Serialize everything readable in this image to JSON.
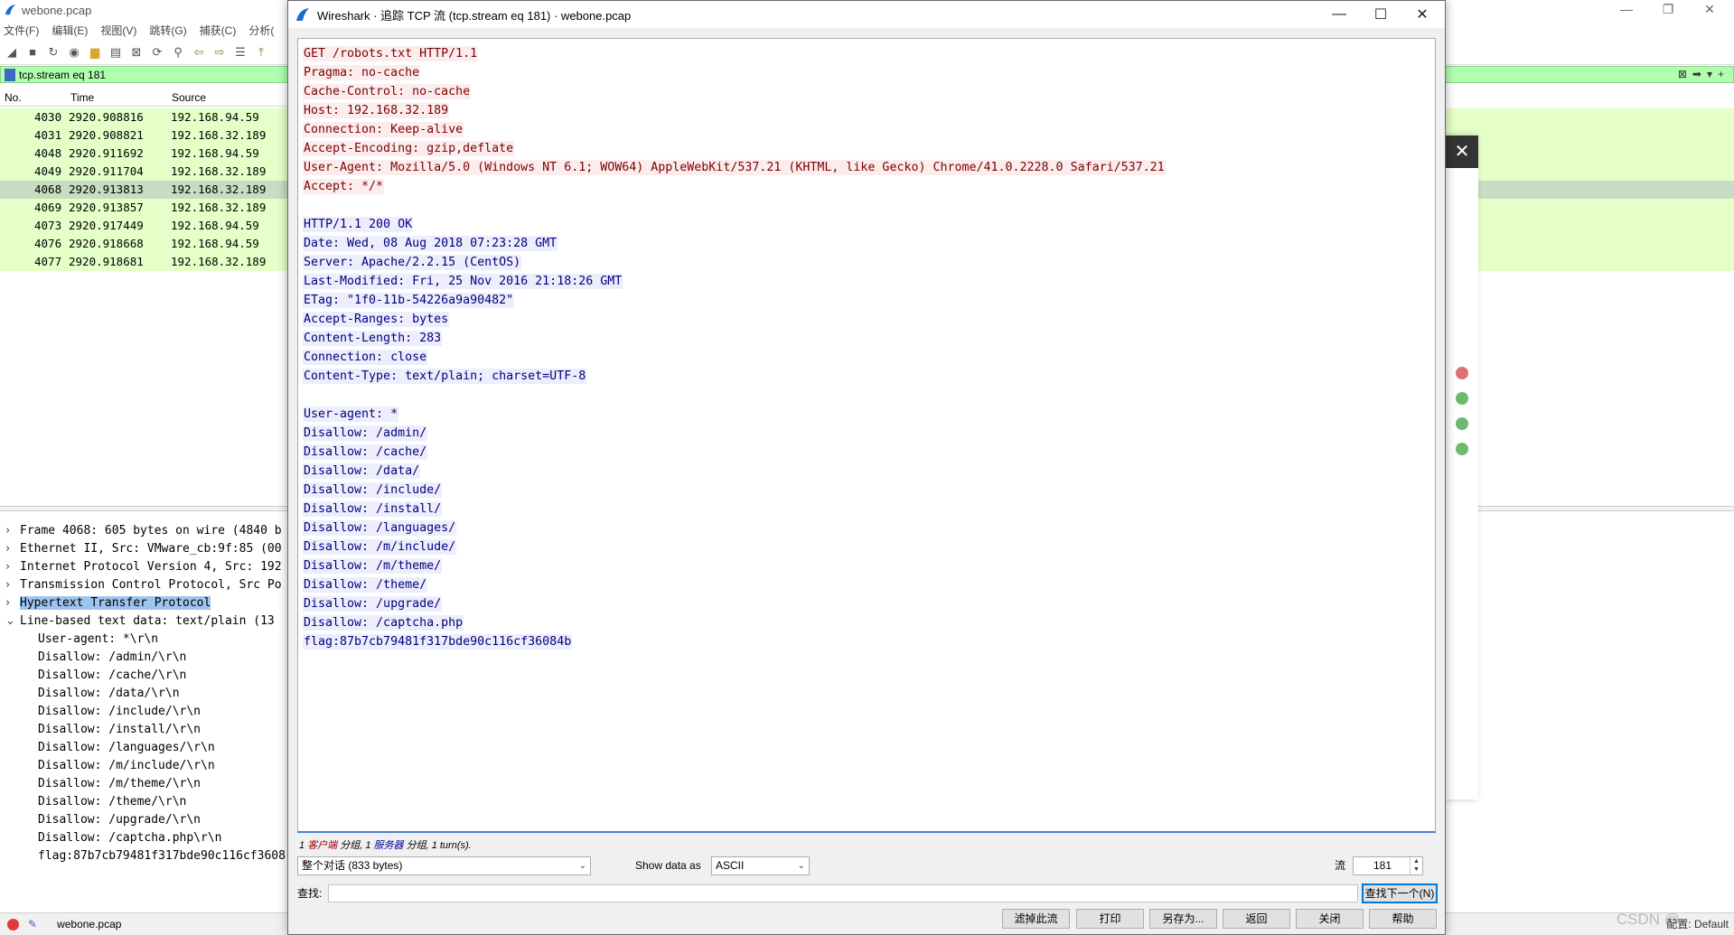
{
  "main_window": {
    "title": "webone.pcap",
    "menu": [
      "文件(F)",
      "编辑(E)",
      "视图(V)",
      "跳转(G)",
      "捕获(C)",
      "分析("
    ],
    "filter": "tcp.stream eq 181",
    "columns": {
      "no": "No.",
      "time": "Time",
      "source": "Source"
    },
    "packets": [
      {
        "no": "4030",
        "time": "2920.908816",
        "source": "192.168.94.59"
      },
      {
        "no": "4031",
        "time": "2920.908821",
        "source": "192.168.32.189"
      },
      {
        "no": "4048",
        "time": "2920.911692",
        "source": "192.168.94.59"
      },
      {
        "no": "4049",
        "time": "2920.911704",
        "source": "192.168.32.189"
      },
      {
        "no": "4068",
        "time": "2920.913813",
        "source": "192.168.32.189"
      },
      {
        "no": "4069",
        "time": "2920.913857",
        "source": "192.168.32.189"
      },
      {
        "no": "4073",
        "time": "2920.917449",
        "source": "192.168.94.59"
      },
      {
        "no": "4076",
        "time": "2920.918668",
        "source": "192.168.94.59"
      },
      {
        "no": "4077",
        "time": "2920.918681",
        "source": "192.168.32.189"
      }
    ],
    "details": [
      "Frame 4068: 605 bytes on wire (4840 b",
      "Ethernet II, Src: VMware_cb:9f:85 (00",
      "Internet Protocol Version 4, Src: 192",
      "Transmission Control Protocol, Src Po",
      "Hypertext Transfer Protocol",
      "Line-based text data: text/plain (13"
    ],
    "detail_children": [
      "User-agent: *\\r\\n",
      "Disallow: /admin/\\r\\n",
      "Disallow: /cache/\\r\\n",
      "Disallow: /data/\\r\\n",
      "Disallow: /include/\\r\\n",
      "Disallow: /install/\\r\\n",
      "Disallow: /languages/\\r\\n",
      "Disallow: /m/include/\\r\\n",
      "Disallow: /m/theme/\\r\\n",
      "Disallow: /theme/\\r\\n",
      "Disallow: /upgrade/\\r\\n",
      "Disallow: /captcha.php\\r\\n",
      "flag:87b7cb79481f317bde90c116cf3608"
    ],
    "status_file": "webone.pcap",
    "watermark": "CSDN @",
    "profile": "配置: Default"
  },
  "dialog": {
    "title": "Wireshark · 追踪 TCP 流 (tcp.stream eq 181) · webone.pcap",
    "client_lines": [
      "GET /robots.txt HTTP/1.1",
      "Pragma: no-cache",
      "Cache-Control: no-cache",
      "Host: 192.168.32.189",
      "Connection: Keep-alive",
      "Accept-Encoding: gzip,deflate",
      "User-Agent: Mozilla/5.0 (Windows NT 6.1; WOW64) AppleWebKit/537.21 (KHTML, like Gecko) Chrome/41.0.2228.0 Safari/537.21",
      "Accept: */*"
    ],
    "server_lines": [
      "HTTP/1.1 200 OK",
      "Date: Wed, 08 Aug 2018 07:23:28 GMT",
      "Server: Apache/2.2.15 (CentOS)",
      "Last-Modified: Fri, 25 Nov 2016 21:18:26 GMT",
      "ETag: \"1f0-11b-54226a9a90482\"",
      "Accept-Ranges: bytes",
      "Content-Length: 283",
      "Connection: close",
      "Content-Type: text/plain; charset=UTF-8"
    ],
    "server_body": [
      "User-agent: *",
      "Disallow: /admin/",
      "Disallow: /cache/",
      "Disallow: /data/",
      "Disallow: /include/",
      "Disallow: /install/",
      "Disallow: /languages/",
      "Disallow: /m/include/",
      "Disallow: /m/theme/",
      "Disallow: /theme/",
      "Disallow: /upgrade/",
      "Disallow: /captcha.php",
      "flag:87b7cb79481f317bde90c116cf36084b"
    ],
    "summary": {
      "p1": "1 ",
      "client": "客户端",
      "p2": " 分组, 1 ",
      "server": "服务器",
      "p3": " 分组, 1 turn(s)."
    },
    "conversation_select": "整个对话 (833 bytes)",
    "show_data_label": "Show data as",
    "show_data_value": "ASCII",
    "stream_label": "流",
    "stream_value": "181",
    "find_label": "查找:",
    "find_value": "",
    "find_next_label": "查找下一个(N)",
    "buttons": {
      "filter_out": "滤掉此流",
      "print": "打印",
      "save_as": "另存为...",
      "back": "返回",
      "close": "关闭",
      "help": "帮助"
    },
    "colors": {
      "client_fg": "#7f0000",
      "client_bg": "#fbeded",
      "server_fg": "#00007f",
      "server_bg": "#ededfb"
    }
  }
}
